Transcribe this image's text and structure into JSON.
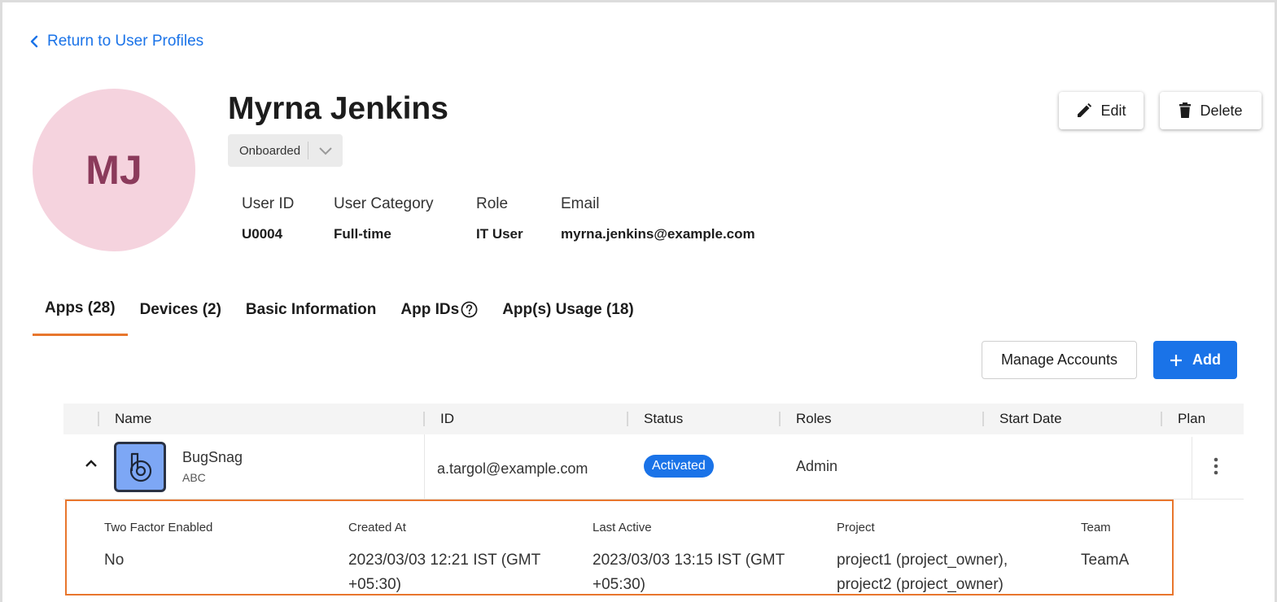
{
  "nav": {
    "back_label": "Return to User Profiles"
  },
  "profile": {
    "initials": "MJ",
    "name": "Myrna Jenkins",
    "status": "Onboarded",
    "fields": [
      {
        "label": "User ID",
        "value": "U0004"
      },
      {
        "label": "User Category",
        "value": "Full-time"
      },
      {
        "label": "Role",
        "value": "IT User"
      },
      {
        "label": "Email",
        "value": "myrna.jenkins@example.com"
      }
    ],
    "avatar_bg": "#f5d3de",
    "avatar_fg": "#8b3a5b"
  },
  "actions": {
    "edit_label": "Edit",
    "delete_label": "Delete"
  },
  "tabs": [
    {
      "label": "Apps (28)",
      "active": true
    },
    {
      "label": "Devices (2)"
    },
    {
      "label": "Basic Information"
    },
    {
      "label": "App IDs",
      "icon": "help-circle-icon"
    },
    {
      "label": "App(s) Usage (18)"
    }
  ],
  "toolbar": {
    "manage_label": "Manage Accounts",
    "add_label": "Add"
  },
  "table": {
    "columns": [
      "Name",
      "ID",
      "Status",
      "Roles",
      "Start Date",
      "Plan"
    ],
    "row": {
      "app_name": "BugSnag",
      "app_sub": "ABC",
      "id": "a.targol@example.com",
      "status": "Activated",
      "roles": "Admin",
      "start_date": "",
      "plan": ""
    },
    "details": [
      {
        "label": "Two Factor Enabled",
        "value": "No"
      },
      {
        "label": "Created At",
        "value": "2023/03/03 12:21 IST (GMT +05:30)"
      },
      {
        "label": "Last Active",
        "value": "2023/03/03 13:15 IST (GMT +05:30)"
      },
      {
        "label": "Project",
        "value": "project1 (project_owner), project2 (project_owner)"
      },
      {
        "label": "Team",
        "value": "TeamA"
      }
    ]
  },
  "colors": {
    "accent": "#1a73e8",
    "tab_underline": "#e8762d",
    "highlight_border": "#e8762d"
  }
}
